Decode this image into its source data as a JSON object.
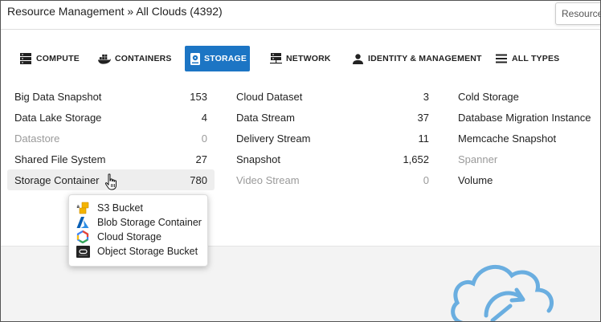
{
  "header": {
    "title": "Resource Management » All Clouds (4392)",
    "search_value": "Resource"
  },
  "tabs": [
    {
      "label": "COMPUTE",
      "icon": "server-icon",
      "active": false
    },
    {
      "label": "CONTAINERS",
      "icon": "docker-icon",
      "active": false
    },
    {
      "label": "STORAGE",
      "icon": "hard-drive-icon",
      "active": true
    },
    {
      "label": "NETWORK",
      "icon": "network-icon",
      "active": false
    },
    {
      "label": "IDENTITY & MANAGEMENT",
      "icon": "person-icon",
      "active": false
    },
    {
      "label": "ALL TYPES",
      "icon": "menu-icon",
      "active": false
    }
  ],
  "columns": [
    [
      {
        "label": "Big Data Snapshot",
        "count": "153",
        "muted": false
      },
      {
        "label": "Data Lake Storage",
        "count": "4",
        "muted": false
      },
      {
        "label": "Datastore",
        "count": "0",
        "muted": true
      },
      {
        "label": "Shared File System",
        "count": "27",
        "muted": false
      },
      {
        "label": "Storage Container",
        "count": "780",
        "muted": false,
        "hover": true
      }
    ],
    [
      {
        "label": "Cloud Dataset",
        "count": "3",
        "muted": false
      },
      {
        "label": "Data Stream",
        "count": "37",
        "muted": false
      },
      {
        "label": "Delivery Stream",
        "count": "11",
        "muted": false
      },
      {
        "label": "Snapshot",
        "count": "1,652",
        "muted": false
      },
      {
        "label": "Video Stream",
        "count": "0",
        "muted": true
      }
    ],
    [
      {
        "label": "Cold Storage",
        "muted": false
      },
      {
        "label": "Database Migration Instance",
        "muted": false
      },
      {
        "label": "Memcache Snapshot",
        "muted": false
      },
      {
        "label": "Spanner",
        "muted": true
      },
      {
        "label": "Volume",
        "muted": false
      }
    ]
  ],
  "popup": {
    "items": [
      {
        "label": "S3 Bucket",
        "icon": "aws-s3-icon"
      },
      {
        "label": "Blob Storage Container",
        "icon": "azure-icon"
      },
      {
        "label": "Cloud Storage",
        "icon": "google-cloud-icon"
      },
      {
        "label": "Object Storage Bucket",
        "icon": "oracle-cloud-icon"
      }
    ]
  },
  "colors": {
    "accent": "#1c75c4",
    "muted_text": "#9a9a9a",
    "cloud_icon": "#6aaee0"
  }
}
